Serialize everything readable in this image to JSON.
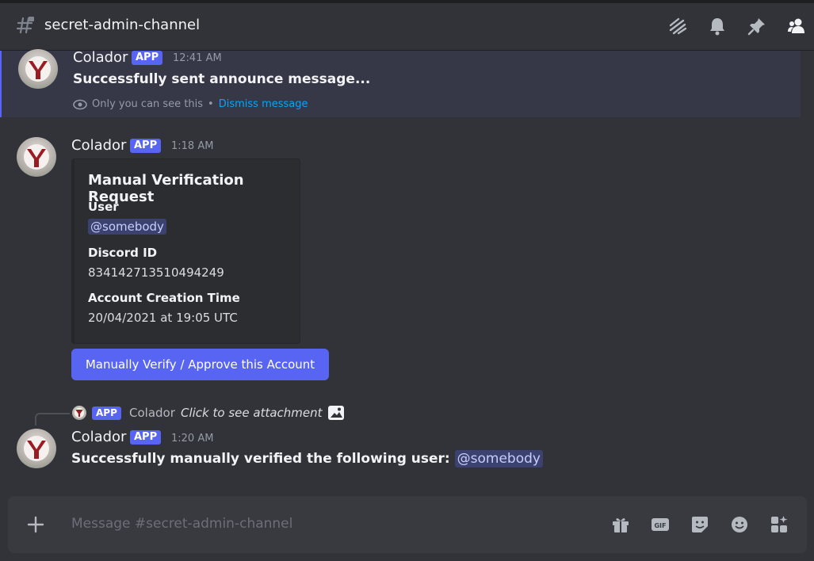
{
  "header": {
    "channel_name": "secret-admin-channel"
  },
  "messages": [
    {
      "author": "Colador",
      "tag": "APP",
      "time": "12:41 AM",
      "text": "Successfully sent announce message...",
      "ephemeral_note": "Only you can see this",
      "separator": "•",
      "dismiss_label": "Dismiss message"
    },
    {
      "author": "Colador",
      "tag": "APP",
      "time": "1:18 AM",
      "embed": {
        "title": "Manual Verification Request",
        "fields": [
          {
            "name": "User",
            "value": "@somebody"
          },
          {
            "name": "Discord ID",
            "value": "834142713510494249"
          },
          {
            "name": "Account Creation Time",
            "value": "20/04/2021 at 19:05 UTC"
          }
        ]
      },
      "button_label": "Manually Verify / Approve this Account"
    },
    {
      "reply": {
        "tag": "APP",
        "author": "Colador",
        "text": "Click to see attachment"
      },
      "author": "Colador",
      "tag": "APP",
      "time": "1:20 AM",
      "text": "Successfully manually verified the following user:",
      "mention": "@somebody"
    }
  ],
  "input": {
    "placeholder": "Message #secret-admin-channel"
  },
  "icons": {
    "header": [
      "threads-icon",
      "bell-icon",
      "pin-icon",
      "members-icon"
    ],
    "input": [
      "gift-icon",
      "gif-icon",
      "sticker-icon",
      "emoji-icon",
      "apps-icon"
    ]
  },
  "colors": {
    "accent": "#5865f2",
    "background": "#313338",
    "link": "#00a8fc"
  }
}
